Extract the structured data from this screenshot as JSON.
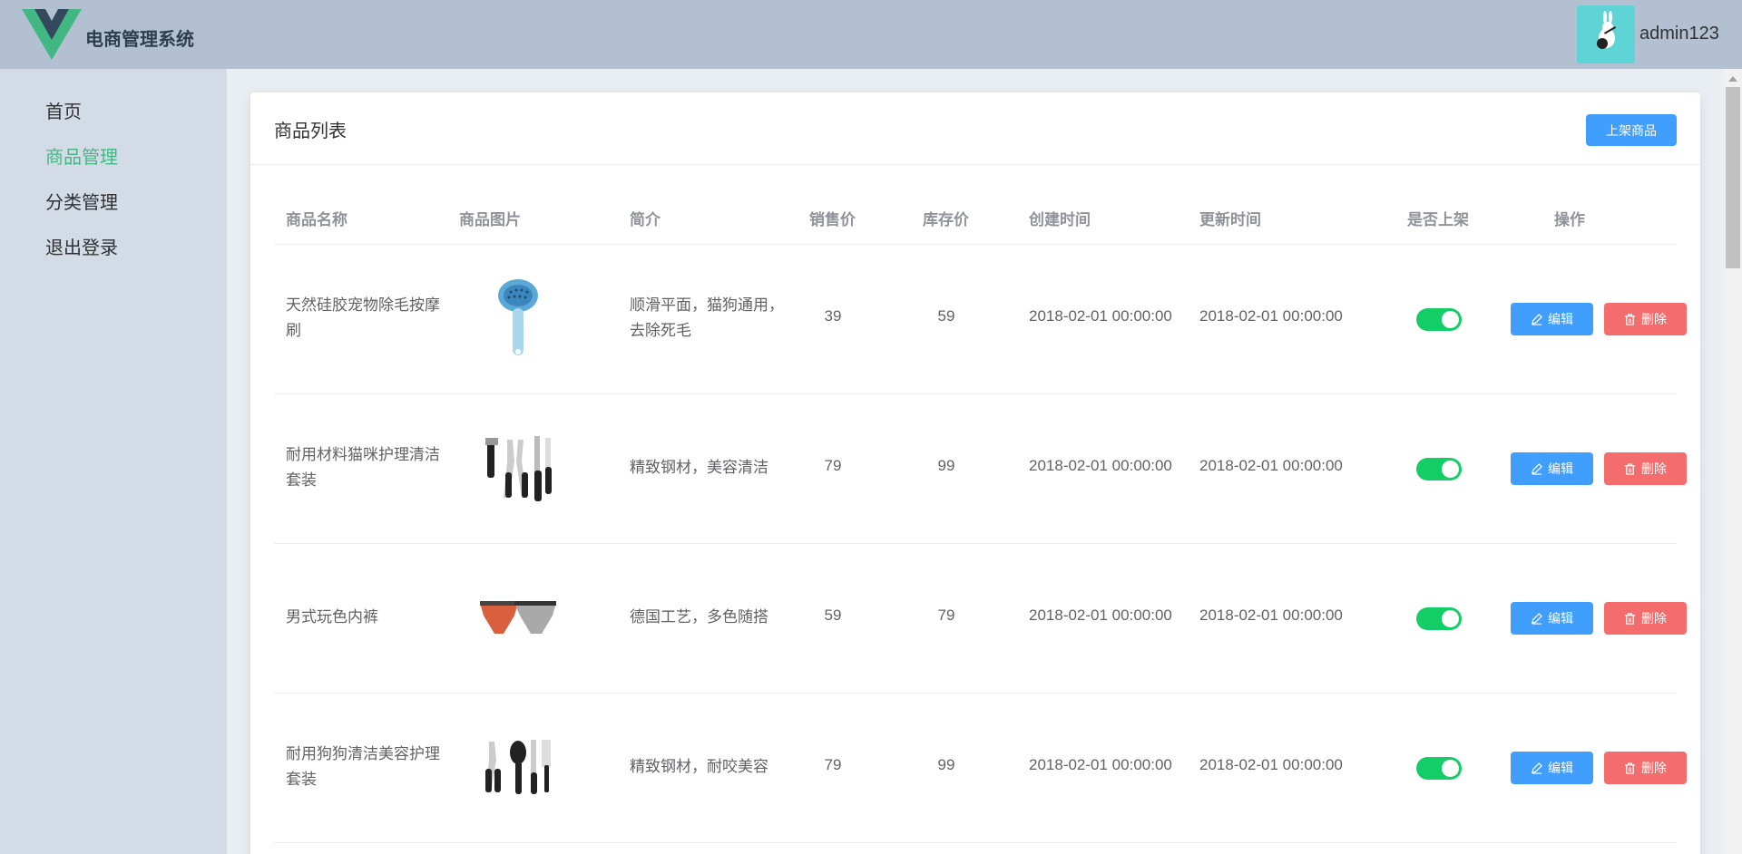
{
  "header": {
    "app_title": "电商管理系统",
    "username": "admin123",
    "logo_icon": "vue-logo-icon",
    "avatar_icon": "avatar-rabbit-icon"
  },
  "sidebar": {
    "items": [
      {
        "label": "首页",
        "active": false
      },
      {
        "label": "商品管理",
        "active": true
      },
      {
        "label": "分类管理",
        "active": false
      },
      {
        "label": "退出登录",
        "active": false
      }
    ]
  },
  "main": {
    "title": "商品列表",
    "add_button": "上架商品",
    "columns": [
      "商品名称",
      "商品图片",
      "简介",
      "销售价",
      "库存价",
      "创建时间",
      "更新时间",
      "是否上架",
      "操作"
    ],
    "edit_label": "编辑",
    "delete_label": "删除",
    "rows": [
      {
        "name": "天然硅胶宠物除毛按摩刷",
        "image": "pet-brush-image",
        "desc": "顺滑平面，猫狗通用，去除死毛",
        "price": "39",
        "stock": "59",
        "created": "2018-02-01 00:00:00",
        "updated": "2018-02-01 00:00:00",
        "on_sale": true
      },
      {
        "name": "耐用材料猫咪护理清洁套装",
        "image": "cat-grooming-kit-image",
        "desc": "精致钢材，美容清洁",
        "price": "79",
        "stock": "99",
        "created": "2018-02-01 00:00:00",
        "updated": "2018-02-01 00:00:00",
        "on_sale": true
      },
      {
        "name": "男式玩色内裤",
        "image": "mens-underwear-image",
        "desc": "德国工艺，多色随搭",
        "price": "59",
        "stock": "79",
        "created": "2018-02-01 00:00:00",
        "updated": "2018-02-01 00:00:00",
        "on_sale": true
      },
      {
        "name": "耐用狗狗清洁美容护理套装",
        "image": "dog-grooming-kit-image",
        "desc": "精致钢材，耐咬美容",
        "price": "79",
        "stock": "99",
        "created": "2018-02-01 00:00:00",
        "updated": "2018-02-01 00:00:00",
        "on_sale": true
      }
    ]
  },
  "colors": {
    "header_bg": "#b3c0d1",
    "sidebar_bg": "#d3dce6",
    "main_bg": "#e9eef3",
    "active_menu": "#42b983",
    "primary": "#409eff",
    "danger": "#f56c6c",
    "switch_on": "#13ce66"
  }
}
